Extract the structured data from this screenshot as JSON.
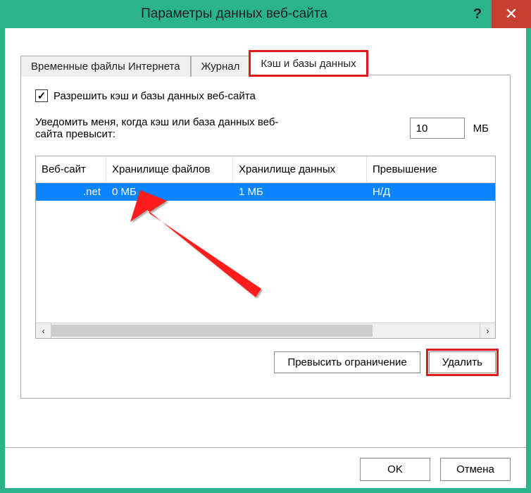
{
  "title": "Параметры данных веб-сайта",
  "help_symbol": "?",
  "close_symbol": "✕",
  "tabs": [
    {
      "label": "Временные файлы Интернета",
      "active": false
    },
    {
      "label": "Журнал",
      "active": false
    },
    {
      "label": "Кэш и базы данных",
      "active": true,
      "highlighted": true
    }
  ],
  "allow_checkbox": {
    "checked": true,
    "label": "Разрешить кэш и базы данных веб-сайта"
  },
  "notify": {
    "label": "Уведомить меня, когда кэш или база данных веб-сайта превысит:",
    "value": "10",
    "unit": "МБ"
  },
  "table": {
    "columns": [
      "Веб-сайт",
      "Хранилище файлов",
      "Хранилище данных",
      "Превышение"
    ],
    "rows": [
      {
        "site": ".net",
        "filestore": "0 МБ",
        "datastore": "1 МБ",
        "excess": "Н/Д",
        "selected": true
      }
    ]
  },
  "panel_buttons": {
    "exceed": "Превысить ограничение",
    "delete": "Удалить"
  },
  "footer": {
    "ok": "OK",
    "cancel": "Отмена"
  }
}
